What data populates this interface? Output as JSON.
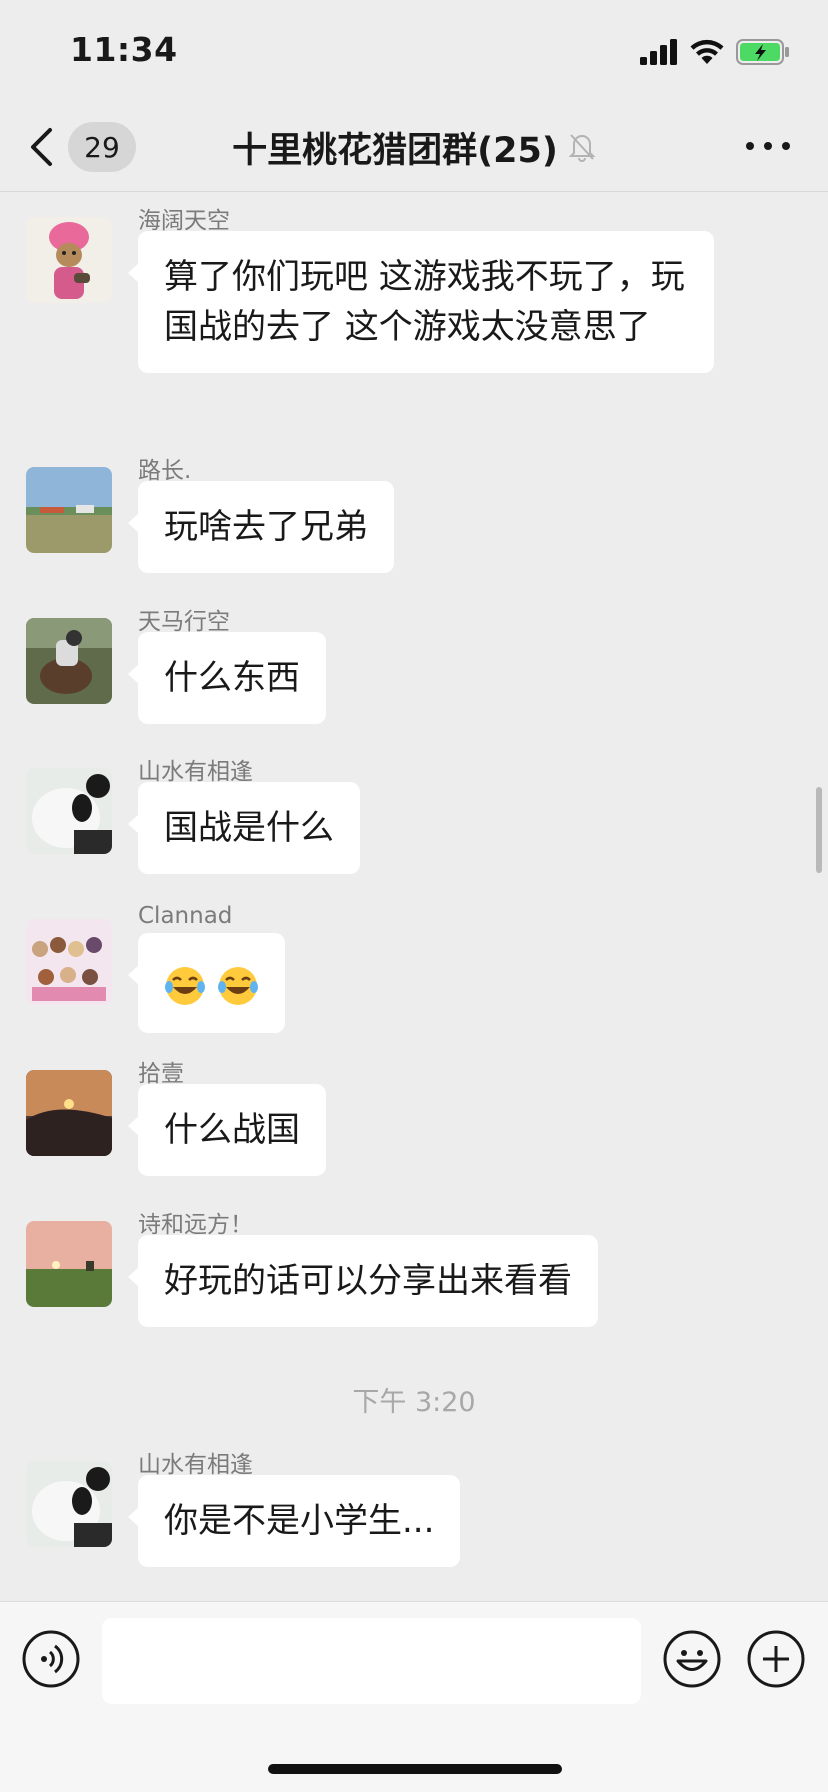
{
  "status_bar": {
    "time": "11:34",
    "battery_color": "#4cd964"
  },
  "nav": {
    "unread_count": "29",
    "title": "十里桃花猎团群(25)"
  },
  "messages": [
    {
      "sender": "海阔天空",
      "text": "算了你们玩吧 这游戏我不玩了，玩国战的去了 这个游戏太没意思了",
      "avatar": "cat-turban-avatar"
    },
    {
      "sender": "路长.",
      "text": "玩啥去了兄弟",
      "avatar": "landscape-avatar"
    },
    {
      "sender": "天马行空",
      "text": "什么东西",
      "avatar": "rider-avatar"
    },
    {
      "sender": "山水有相逢",
      "text": "国战是什么",
      "avatar": "panda-avatar"
    },
    {
      "sender": "Clannad",
      "text": "",
      "emojis": [
        "laughing-crying-emoji",
        "laughing-crying-emoji"
      ],
      "avatar": "anime-group-avatar"
    },
    {
      "sender": "拾壹",
      "text": "什么战国",
      "avatar": "sunset-mountain-avatar"
    },
    {
      "sender": "诗和远方！",
      "text": "好玩的话可以分享出来看看",
      "avatar": "sunset-field-avatar"
    },
    {
      "sender": "山水有相逢",
      "text": "你是不是小学生...",
      "avatar": "panda-avatar"
    }
  ],
  "timestamp": "下午 3:20",
  "input": {
    "value": "",
    "placeholder": ""
  },
  "colors": {
    "background": "#ededed",
    "bubble": "#ffffff",
    "sender_name": "#7b7b7b"
  }
}
